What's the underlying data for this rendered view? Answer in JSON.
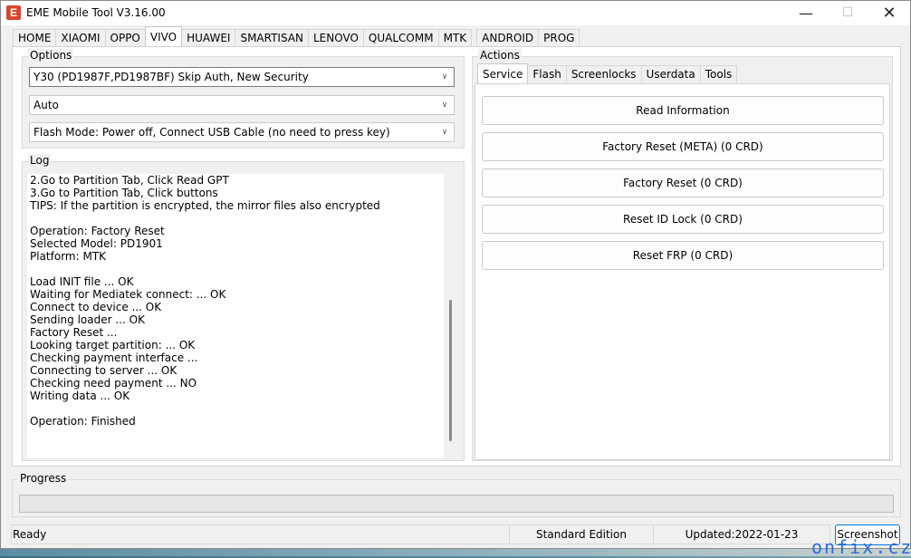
{
  "window": {
    "app_icon_letter": "E",
    "title": "EME Mobile Tool V3.16.00",
    "minimize_glyph": "—",
    "maximize_glyph": "☐",
    "close_glyph": "✕"
  },
  "tabs": [
    "HOME",
    "XIAOMI",
    "OPPO",
    "VIVO",
    "HUAWEI",
    "SMARTISAN",
    "LENOVO",
    "QUALCOMM",
    "MTK",
    "ANDROID",
    "PROG"
  ],
  "active_tab": "VIVO",
  "options": {
    "label": "Options",
    "model": "Y30 (PD1987F,PD1987BF) Skip Auth, New Security",
    "port": "Auto",
    "flash_mode": "Flash Mode: Power off, Connect USB Cable (no need to press key)",
    "arrow_glyph": "∨"
  },
  "log": {
    "label": "Log",
    "lines": [
      "2.Go to Partition Tab, Click Read GPT",
      "3.Go to Partition Tab, Click buttons",
      "TIPS: If the partition is encrypted, the mirror files also encrypted",
      "",
      "Operation: Factory Reset",
      "Selected Model: PD1901",
      "Platform: MTK",
      "",
      "Load INIT file ... OK",
      "Waiting for Mediatek connect: ... OK",
      "Connect to device ... OK",
      "Sending loader ... OK",
      "Factory Reset ...",
      "Looking target partition: ... OK",
      "Checking payment interface ...",
      "Connecting to server ... OK",
      "Checking need payment ... NO",
      "Writing data ... OK",
      "",
      "Operation: Finished"
    ]
  },
  "actions": {
    "label": "Actions",
    "subtabs": [
      "Service",
      "Flash",
      "Screenlocks",
      "Userdata",
      "Tools"
    ],
    "active_subtab": "Service",
    "buttons": [
      "Read Information",
      "Factory Reset (META) (0 CRD)",
      "Factory Reset (0 CRD)",
      "Reset ID Lock (0 CRD)",
      "Reset FRP (0 CRD)"
    ]
  },
  "progress": {
    "label": "Progress",
    "value": 0
  },
  "status": {
    "text": "Ready",
    "edition": "Standard Edition",
    "updated": "Updated:2022-01-23",
    "screenshot_button": "Screenshot"
  },
  "watermark": "onfix.cz",
  "colors": {
    "window_bg": "#f0f0f0",
    "panel_bg": "#ffffff",
    "progress_fill": "#06b025",
    "app_icon": "#d9452c",
    "screenshot_button_border": "#0078d7",
    "watermark": "#2c6bd9"
  }
}
